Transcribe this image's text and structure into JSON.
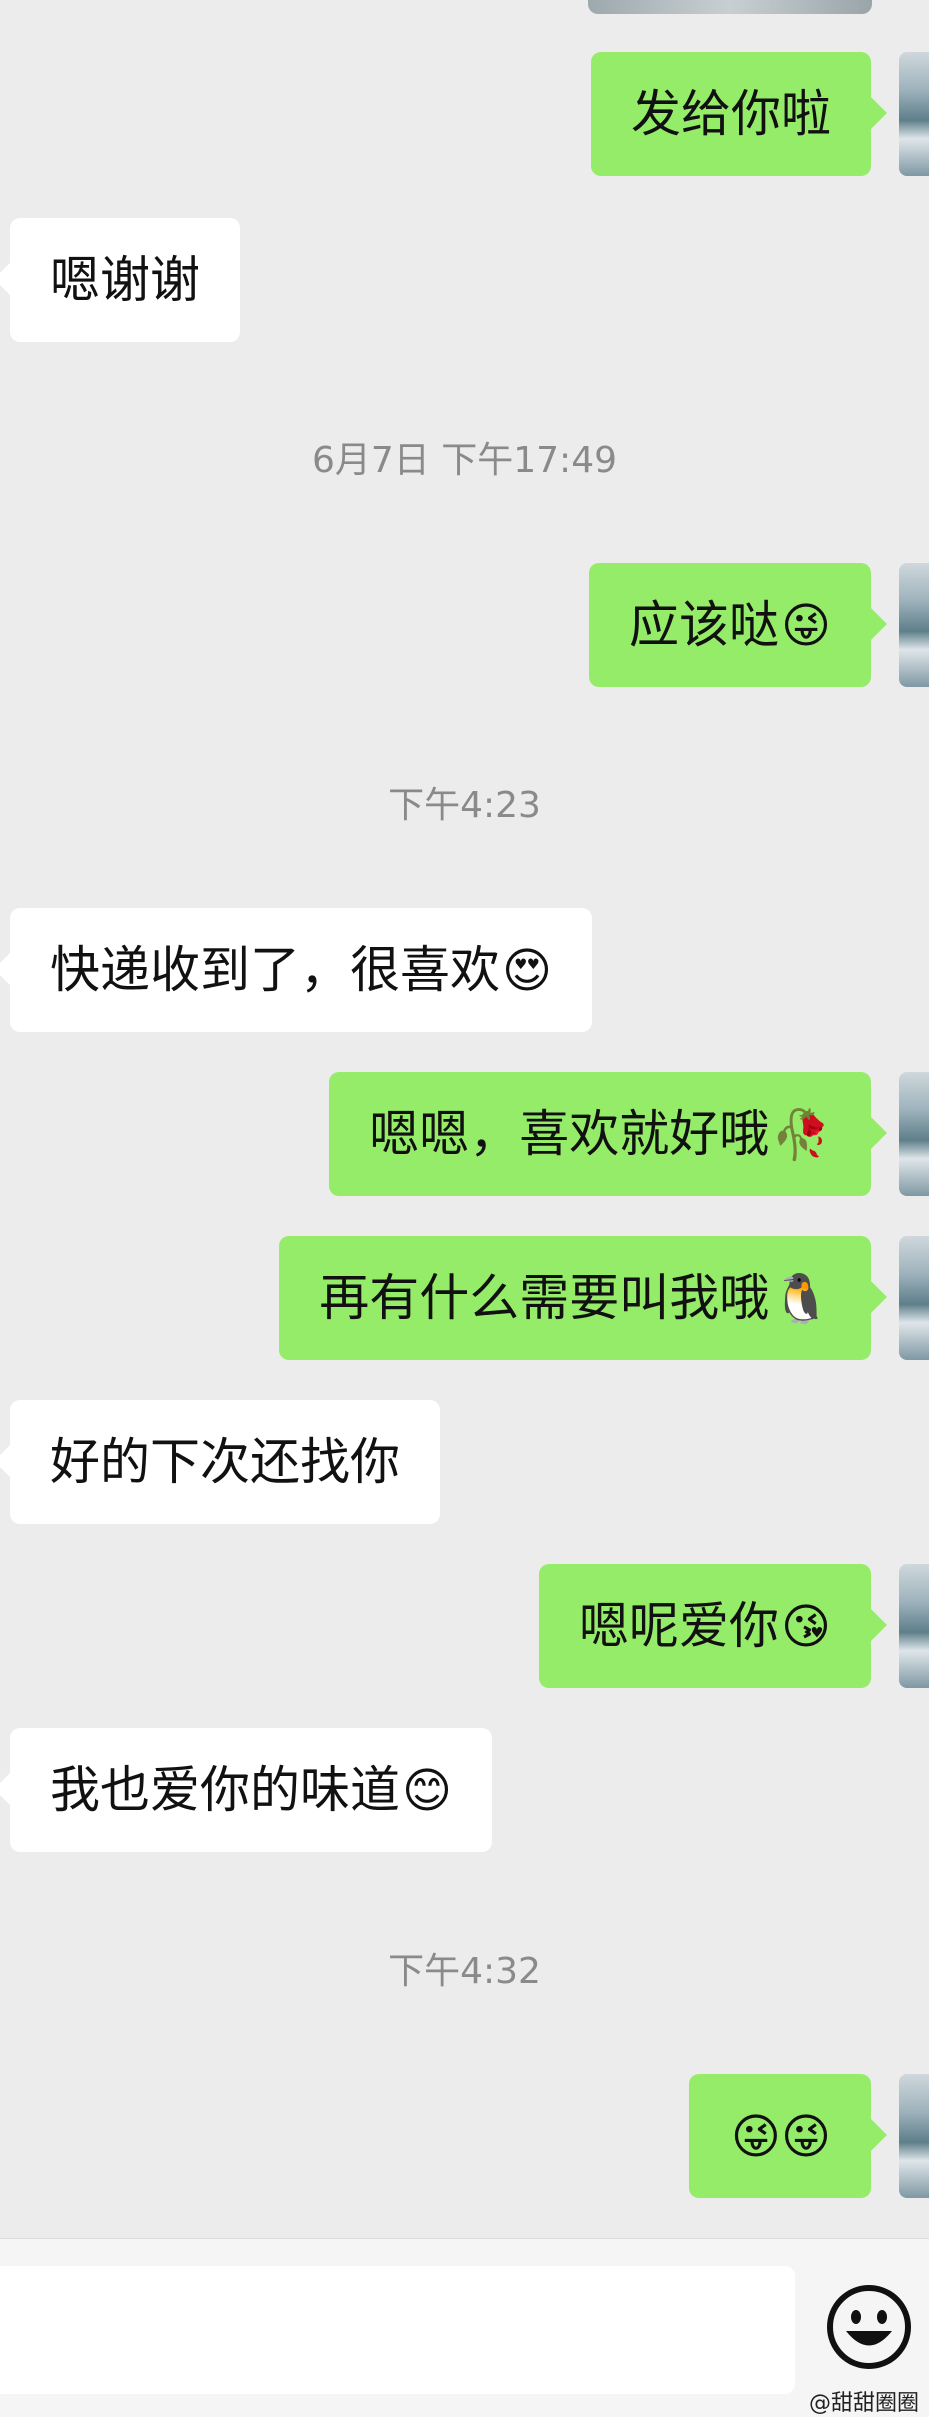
{
  "messages": [
    {
      "dir": "out",
      "text": "发给你啦",
      "emoji": ""
    },
    {
      "dir": "in",
      "text": "嗯谢谢",
      "emoji": ""
    },
    {
      "dir": "out",
      "text": "应该哒",
      "emoji": "😜"
    },
    {
      "dir": "in",
      "text": "快递收到了，很喜欢",
      "emoji": "😍"
    },
    {
      "dir": "out",
      "text": "嗯嗯，喜欢就好哦",
      "emoji": "🥀"
    },
    {
      "dir": "out",
      "text": "再有什么需要叫我哦",
      "emoji": "🐧"
    },
    {
      "dir": "in",
      "text": "好的下次还找你",
      "emoji": ""
    },
    {
      "dir": "out",
      "text": "嗯呢爱你",
      "emoji": "😘"
    },
    {
      "dir": "in",
      "text": "我也爱你的味道",
      "emoji": "😊"
    },
    {
      "dir": "out",
      "text": "",
      "emoji": "😜😜"
    }
  ],
  "timestamps": [
    "6月7日 下午17:49",
    "下午4:23",
    "下午4:32"
  ],
  "input": {
    "placeholder": "",
    "emoji_button": "smiley-face-icon"
  },
  "watermark": "@甜甜圈圈",
  "colors": {
    "background": "#ececec",
    "outgoing_bubble": "#95ec69",
    "incoming_bubble": "#ffffff",
    "timestamp_text": "#8a8a8a"
  }
}
